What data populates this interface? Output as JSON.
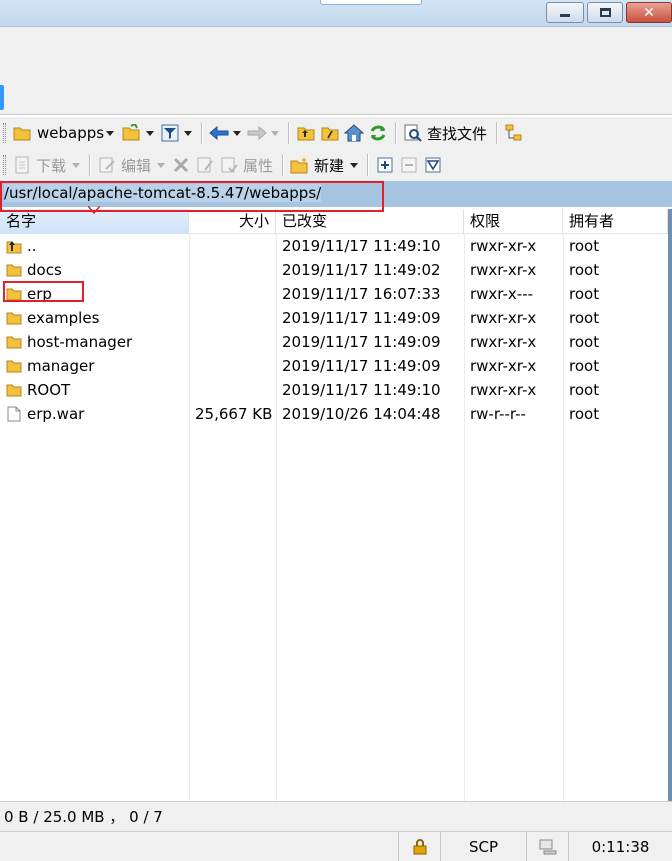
{
  "toolbar1": {
    "directory": "webapps",
    "find_files": "查找文件"
  },
  "toolbar2": {
    "download": "下载",
    "edit": "编辑",
    "properties": "属性",
    "new": "新建"
  },
  "path": "/usr/local/apache-tomcat-8.5.47/webapps/",
  "columns": {
    "name": "名字",
    "size": "大小",
    "modified": "已改变",
    "permissions": "权限",
    "owner": "拥有者"
  },
  "files": [
    {
      "name": "..",
      "size": "",
      "modified": "2019/11/17 11:49:10",
      "permissions": "rwxr-xr-x",
      "owner": "root",
      "icon": "parent-folder-icon"
    },
    {
      "name": "docs",
      "size": "",
      "modified": "2019/11/17 11:49:02",
      "permissions": "rwxr-xr-x",
      "owner": "root",
      "icon": "folder-icon"
    },
    {
      "name": "erp",
      "size": "",
      "modified": "2019/11/17 16:07:33",
      "permissions": "rwxr-x---",
      "owner": "root",
      "icon": "folder-icon"
    },
    {
      "name": "examples",
      "size": "",
      "modified": "2019/11/17 11:49:09",
      "permissions": "rwxr-xr-x",
      "owner": "root",
      "icon": "folder-icon"
    },
    {
      "name": "host-manager",
      "size": "",
      "modified": "2019/11/17 11:49:09",
      "permissions": "rwxr-xr-x",
      "owner": "root",
      "icon": "folder-icon"
    },
    {
      "name": "manager",
      "size": "",
      "modified": "2019/11/17 11:49:09",
      "permissions": "rwxr-xr-x",
      "owner": "root",
      "icon": "folder-icon"
    },
    {
      "name": "ROOT",
      "size": "",
      "modified": "2019/11/17 11:49:10",
      "permissions": "rwxr-xr-x",
      "owner": "root",
      "icon": "folder-icon"
    },
    {
      "name": "erp.war",
      "size": "25,667 KB",
      "modified": "2019/10/26 14:04:48",
      "permissions": "rw-r--r--",
      "owner": "root",
      "icon": "file-icon"
    }
  ],
  "status": {
    "selection": "0 B / 25.0 MB ， 0 / 7",
    "protocol": "SCP",
    "elapsed": "0:11:38"
  },
  "colors": {
    "accent": "#3399ff",
    "path_bar": "#a6c3df",
    "highlight": "#e0202a",
    "folder": "#f2c23c"
  }
}
